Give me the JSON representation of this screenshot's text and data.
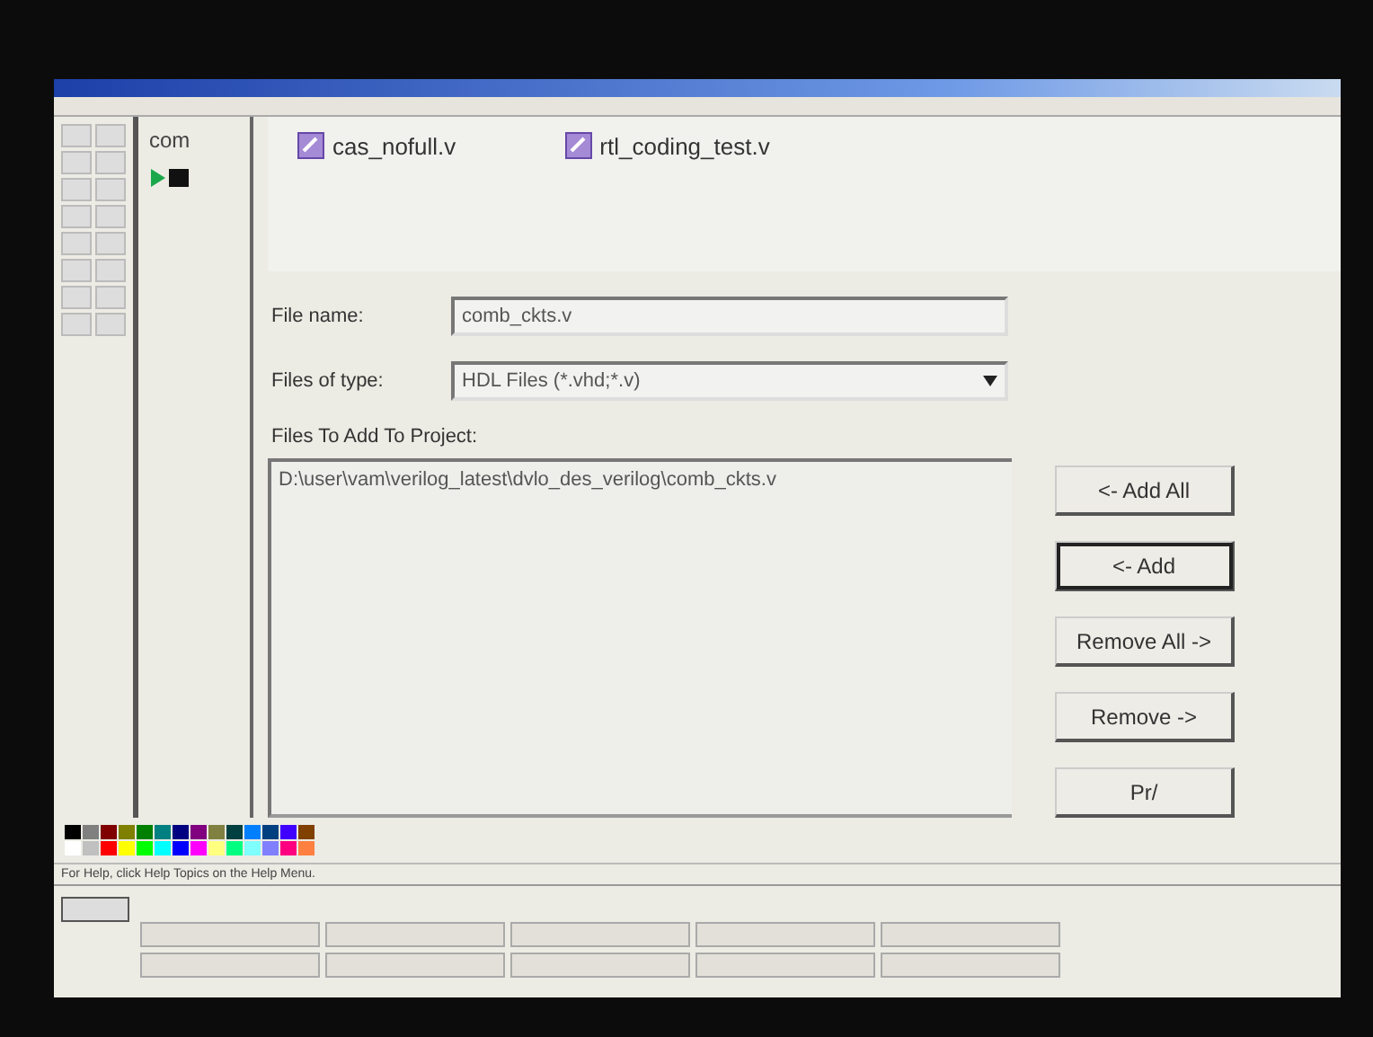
{
  "toolbox_label": "com",
  "file_list": [
    {
      "name": "cas_nofull.v"
    },
    {
      "name": "rtl_coding_test.v"
    }
  ],
  "file_name": {
    "label": "File name:",
    "value": "comb_ckts.v"
  },
  "file_type": {
    "label": "Files of type:",
    "value": "HDL Files (*.vhd;*.v)"
  },
  "project_files": {
    "label": "Files To Add To Project:",
    "items": [
      "D:\\user\\vam\\verilog_latest\\dvlo_des_verilog\\comb_ckts.v"
    ]
  },
  "buttons": [
    {
      "label": "<- Add All",
      "selected": false
    },
    {
      "label": "<- Add",
      "selected": true
    },
    {
      "label": "Remove All ->",
      "selected": false
    },
    {
      "label": "Remove ->",
      "selected": false
    },
    {
      "label": "Pr/",
      "selected": false
    }
  ],
  "palette": [
    {
      "color": "#000000"
    },
    {
      "color": "#ffffff"
    },
    {
      "color": "#808080"
    },
    {
      "color": "#c0c0c0"
    },
    {
      "color": "#800000"
    },
    {
      "color": "#ff0000"
    },
    {
      "color": "#808000"
    },
    {
      "color": "#ffff00"
    },
    {
      "color": "#008000"
    },
    {
      "color": "#00ff00"
    },
    {
      "color": "#008080"
    },
    {
      "color": "#00ffff"
    },
    {
      "color": "#000080"
    },
    {
      "color": "#0000ff"
    },
    {
      "color": "#800080"
    },
    {
      "color": "#ff00ff"
    },
    {
      "color": "#808040"
    },
    {
      "color": "#ffff80"
    },
    {
      "color": "#004040"
    },
    {
      "color": "#00ff80"
    },
    {
      "color": "#0080ff"
    },
    {
      "color": "#80ffff"
    },
    {
      "color": "#004080"
    },
    {
      "color": "#8080ff"
    },
    {
      "color": "#4000ff"
    },
    {
      "color": "#ff0080"
    },
    {
      "color": "#804000"
    },
    {
      "color": "#ff8040"
    }
  ],
  "status_text": "For Help, click Help Topics on the Help Menu."
}
